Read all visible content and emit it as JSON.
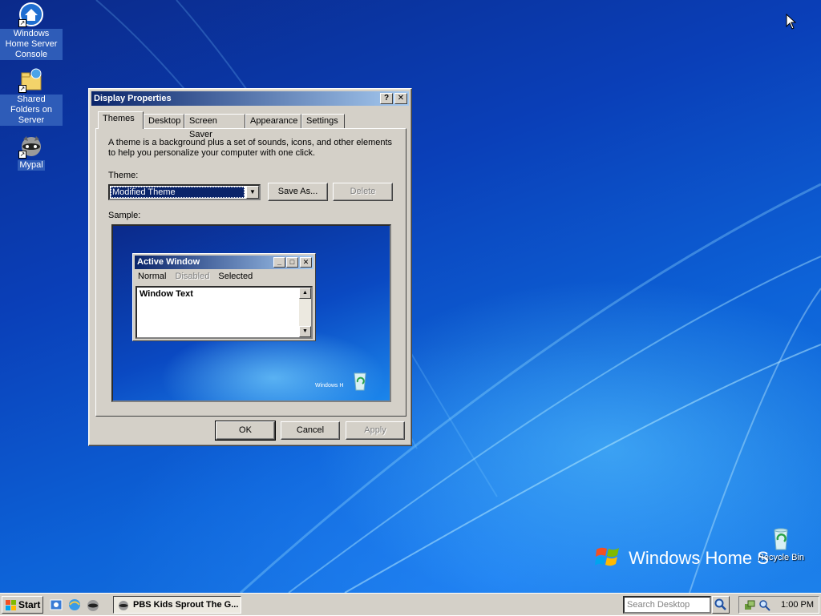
{
  "desktop": {
    "icons": [
      {
        "label": "Windows Home Server Console",
        "icon": "home-server-icon"
      },
      {
        "label": "Shared Folders on Server",
        "icon": "shared-folders-icon"
      },
      {
        "label": "Mypal",
        "icon": "mypal-raccoon-icon"
      },
      {
        "label": "Recycle Bin",
        "icon": "recycle-bin-icon"
      }
    ],
    "brand_text": "Windows Home S"
  },
  "dialog": {
    "title": "Display Properties",
    "help_button": "?",
    "close_button": "✕",
    "tabs": [
      "Themes",
      "Desktop",
      "Screen Saver",
      "Appearance",
      "Settings"
    ],
    "active_tab": "Themes",
    "description": "A theme is a background plus a set of sounds, icons, and other elements to help you personalize your computer with one click.",
    "theme_label": "Theme:",
    "theme_value": "Modified Theme",
    "save_as_label": "Save As...",
    "delete_label": "Delete",
    "sample_label": "Sample:",
    "sample": {
      "window_title": "Active Window",
      "menu_normal": "Normal",
      "menu_disabled": "Disabled",
      "menu_selected": "Selected",
      "window_text": "Window Text",
      "brand_text": "Windows H"
    },
    "ok_label": "OK",
    "cancel_label": "Cancel",
    "apply_label": "Apply"
  },
  "taskbar": {
    "start_label": "Start",
    "task_label": "PBS Kids Sprout The G...",
    "search_placeholder": "Search Desktop",
    "clock": "1:00 PM"
  },
  "colors": {
    "title_active_start": "#0a246a",
    "title_active_end": "#a6caf0",
    "face": "#d4d0c8",
    "desktop_blue": "#0a3fb8"
  }
}
